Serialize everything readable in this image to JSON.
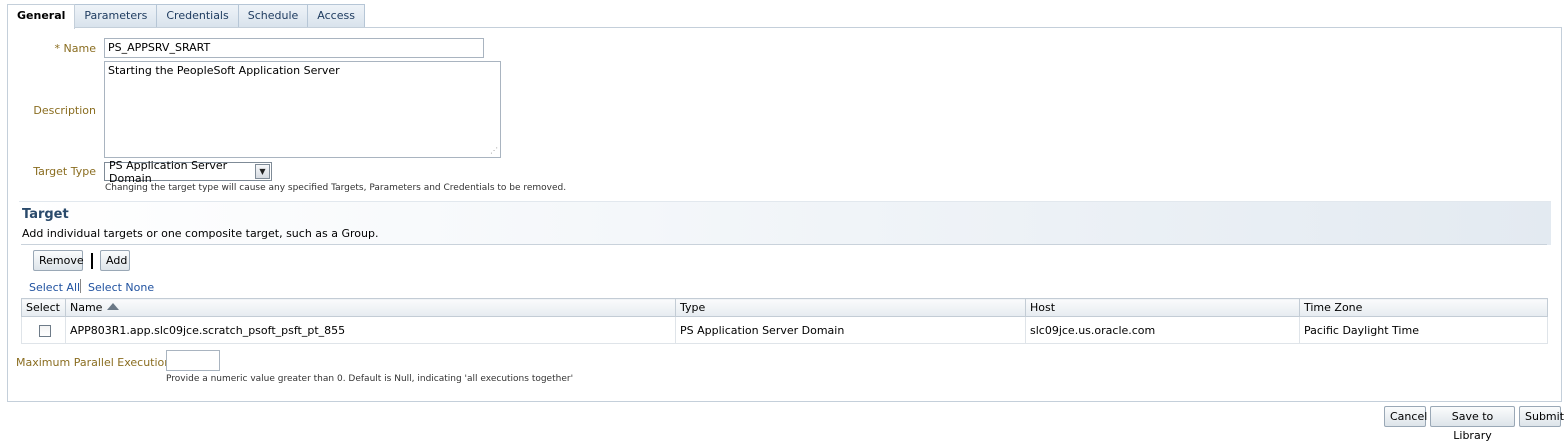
{
  "tabs": [
    {
      "label": "General",
      "active": true
    },
    {
      "label": "Parameters",
      "active": false
    },
    {
      "label": "Credentials",
      "active": false
    },
    {
      "label": "Schedule",
      "active": false
    },
    {
      "label": "Access",
      "active": false
    }
  ],
  "form": {
    "name_required_mark": "* ",
    "name_label": "Name",
    "name_value": "PS_APPSRV_SRART",
    "description_label": "Description",
    "description_value": "Starting the PeopleSoft Application Server",
    "target_type_label": "Target Type",
    "target_type_value": "PS Application Server Domain",
    "target_type_hint": "Changing the target type will cause any specified Targets, Parameters and Credentials to be removed."
  },
  "target_section": {
    "title": "Target",
    "description": "Add individual targets or one composite target, such as a Group.",
    "remove_label": "Remove",
    "add_label": "Add",
    "select_all_label": "Select All",
    "select_none_label": "Select None",
    "columns": [
      "Select",
      "Name",
      "Type",
      "Host",
      "Time Zone"
    ],
    "rows": [
      {
        "selected": false,
        "name": "APP803R1.app.slc09jce.scratch_psoft_psft_pt_855",
        "type": "PS Application Server Domain",
        "host": "slc09jce.us.oracle.com",
        "time_zone": "Pacific Daylight Time"
      }
    ]
  },
  "max_parallel": {
    "label": "Maximum Parallel Executions",
    "value": "",
    "hint": "Provide a numeric value greater than 0. Default is Null, indicating 'all executions together'"
  },
  "footer": {
    "cancel_label": "Cancel",
    "save_label": "Save to Library",
    "submit_label": "Submit"
  },
  "colors": {
    "label_color": "#8a6d20",
    "link_color": "#2052a0",
    "section_title_color": "#2a4a6b"
  }
}
